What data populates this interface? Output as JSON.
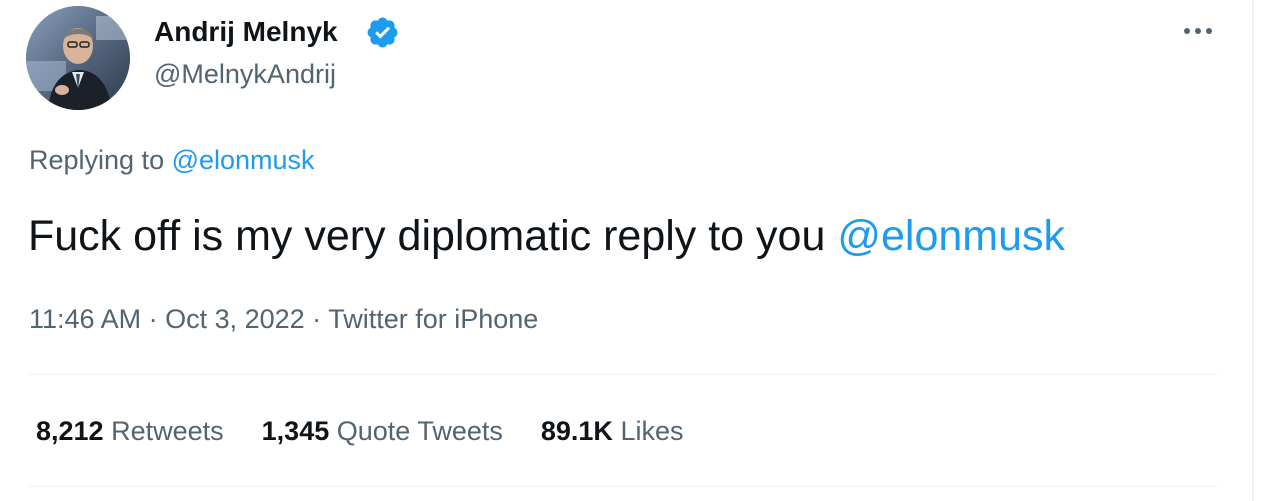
{
  "author": {
    "display_name": "Andrij Melnyk",
    "handle": "@MelnykAndrij",
    "verified_icon": "verified-badge-icon",
    "avatar_icon": "user-avatar"
  },
  "more_icon": "more-options-icon",
  "reply_context": {
    "prefix": "Replying to ",
    "mention": "@elonmusk"
  },
  "tweet": {
    "text": "Fuck off is my very diplomatic reply to you ",
    "mention": "@elonmusk"
  },
  "meta": {
    "time": "11:46 AM",
    "separator": " · ",
    "date": "Oct 3, 2022",
    "source": "Twitter for iPhone"
  },
  "stats": {
    "retweets": {
      "count": "8,212",
      "label": "Retweets"
    },
    "quotes": {
      "count": "1,345",
      "label": "Quote Tweets"
    },
    "likes": {
      "count": "89.1K",
      "label": "Likes"
    }
  },
  "colors": {
    "link": "#1d9bf0",
    "secondary_text": "#536471",
    "primary_text": "#0f1419",
    "divider": "#eff3f4"
  }
}
